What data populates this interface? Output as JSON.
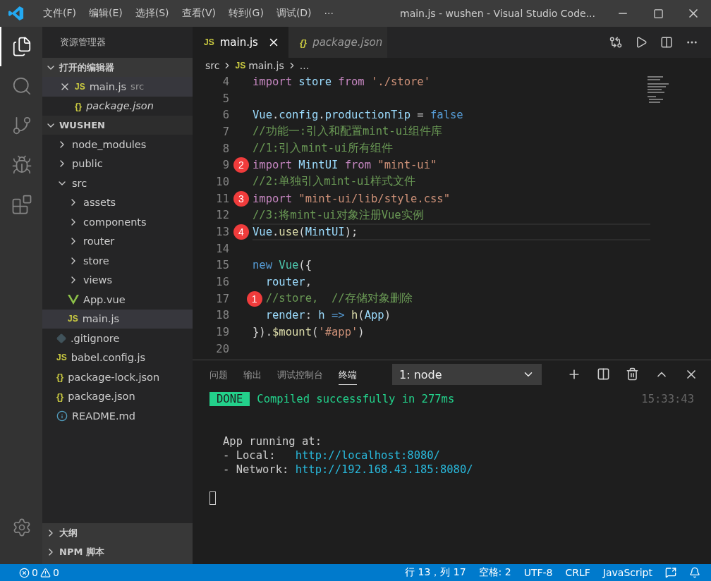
{
  "window": {
    "menus": [
      "文件(F)",
      "编辑(E)",
      "选择(S)",
      "查看(V)",
      "转到(G)",
      "调试(D)"
    ],
    "more": "···",
    "title": "main.js - wushen - Visual Studio Code..."
  },
  "activity_bar": [
    {
      "kind": "files",
      "selected": true
    },
    {
      "kind": "search",
      "selected": false
    },
    {
      "kind": "git",
      "selected": false
    },
    {
      "kind": "debug",
      "selected": false
    },
    {
      "kind": "extensions",
      "selected": false
    }
  ],
  "sidebar": {
    "title": "资源管理器",
    "open_editors": {
      "title": "打开的编辑器",
      "expanded": true,
      "items": [
        {
          "kind": "js",
          "icon": "JS",
          "label": "main.js",
          "hint": "src",
          "italic": false,
          "selected": true
        },
        {
          "kind": "json",
          "icon": "{}",
          "label": "package.json",
          "italic": true,
          "selected": false
        }
      ]
    },
    "project": {
      "title": "WUSHEN",
      "expanded": true,
      "items": [
        {
          "kind": "folder",
          "label": "node_modules",
          "expanded": false,
          "selected": false
        },
        {
          "kind": "folder",
          "label": "public",
          "expanded": false,
          "selected": false
        },
        {
          "kind": "folder",
          "label": "src",
          "expanded": true,
          "selected": false,
          "children": [
            {
              "kind": "folder",
              "label": "assets",
              "expanded": false,
              "selected": false
            },
            {
              "kind": "folder",
              "label": "components",
              "expanded": false,
              "selected": false
            },
            {
              "kind": "folder",
              "label": "router",
              "expanded": false,
              "selected": false
            },
            {
              "kind": "folder",
              "label": "store",
              "expanded": false,
              "selected": false
            },
            {
              "kind": "folder",
              "label": "views",
              "expanded": false,
              "selected": false
            },
            {
              "kind": "vue",
              "label": "App.vue",
              "selected": false
            },
            {
              "kind": "js",
              "icon": "JS",
              "label": "main.js",
              "selected": true
            }
          ]
        },
        {
          "kind": "git",
          "label": ".gitignore",
          "selected": false
        },
        {
          "kind": "js",
          "icon": "JS",
          "label": "babel.config.js",
          "selected": false
        },
        {
          "kind": "json",
          "icon": "{}",
          "label": "package-lock.json",
          "selected": false
        },
        {
          "kind": "json",
          "icon": "{}",
          "label": "package.json",
          "selected": false
        },
        {
          "kind": "info",
          "label": "README.md",
          "selected": false
        }
      ]
    },
    "bottom_sections": [
      {
        "title": "大纲",
        "expanded": false
      },
      {
        "title": "NPM 脚本",
        "expanded": false
      }
    ]
  },
  "tabs": [
    {
      "kind": "js",
      "icon": "JS",
      "label": "main.js",
      "italic": false,
      "selected": true
    },
    {
      "kind": "json",
      "icon": "{}",
      "label": "package.json",
      "italic": true,
      "selected": false
    }
  ],
  "breadcrumb": [
    {
      "label": "src"
    },
    {
      "kind": "js",
      "icon": "JS",
      "label": "main.js"
    },
    {
      "label": "..."
    }
  ],
  "code": [
    {
      "n": "4",
      "current": false,
      "tokens": [
        {
          "kind": "keyword",
          "text": "import "
        },
        {
          "kind": "variable",
          "text": "store "
        },
        {
          "kind": "keyword",
          "text": "from "
        },
        {
          "kind": "string",
          "text": "'./store'"
        }
      ]
    },
    {
      "n": "5",
      "current": false
    },
    {
      "n": "6",
      "current": false,
      "tokens": [
        {
          "kind": "variable",
          "text": "Vue"
        },
        {
          "kind": "plain",
          "text": "."
        },
        {
          "kind": "variable",
          "text": "config"
        },
        {
          "kind": "plain",
          "text": "."
        },
        {
          "kind": "variable",
          "text": "productionTip"
        },
        {
          "kind": "plain",
          "text": " = "
        },
        {
          "kind": "constant",
          "text": "false"
        }
      ]
    },
    {
      "n": "7",
      "current": false,
      "tokens": [
        {
          "kind": "comment",
          "text": "//功能一:引入和配置mint-ui组件库"
        }
      ]
    },
    {
      "n": "8",
      "current": false,
      "tokens": [
        {
          "kind": "comment",
          "text": "//1:引入mint-ui所有组件"
        }
      ]
    },
    {
      "n": "9",
      "current": false,
      "marker": "2",
      "tokens": [
        {
          "kind": "keyword",
          "text": "import "
        },
        {
          "kind": "variable",
          "text": "MintUI "
        },
        {
          "kind": "keyword",
          "text": "from "
        },
        {
          "kind": "string",
          "text": "\"mint-ui\""
        }
      ]
    },
    {
      "n": "10",
      "current": false,
      "tokens": [
        {
          "kind": "comment",
          "text": "//2:单独引入mint-ui样式文件"
        }
      ]
    },
    {
      "n": "11",
      "current": false,
      "marker": "3",
      "tokens": [
        {
          "kind": "keyword",
          "text": "import "
        },
        {
          "kind": "string",
          "text": "\"mint-ui/lib/style.css\""
        }
      ]
    },
    {
      "n": "12",
      "current": false,
      "tokens": [
        {
          "kind": "comment",
          "text": "//3:将mint-ui对象注册Vue实例"
        }
      ]
    },
    {
      "n": "13",
      "current": true,
      "marker": "4",
      "tokens": [
        {
          "kind": "variable",
          "text": "Vue"
        },
        {
          "kind": "plain",
          "text": "."
        },
        {
          "kind": "function",
          "text": "use"
        },
        {
          "kind": "plain",
          "text": "("
        },
        {
          "kind": "variable",
          "text": "MintUI"
        },
        {
          "kind": "plain",
          "text": ");"
        }
      ]
    },
    {
      "n": "14",
      "current": false
    },
    {
      "n": "15",
      "current": false,
      "tokens": [
        {
          "kind": "constant",
          "text": "new "
        },
        {
          "kind": "class",
          "text": "Vue"
        },
        {
          "kind": "plain",
          "text": "({"
        }
      ]
    },
    {
      "n": "16",
      "current": false,
      "tokens": [
        {
          "kind": "variable",
          "text": "  router"
        },
        {
          "kind": "plain",
          "text": ","
        }
      ]
    },
    {
      "n": "17",
      "current": false,
      "marker": "1",
      "tokens": [
        {
          "kind": "comment",
          "text": "  //store,  //存储对象删除"
        }
      ]
    },
    {
      "n": "18",
      "current": false,
      "tokens": [
        {
          "kind": "variable",
          "text": "  render"
        },
        {
          "kind": "plain",
          "text": ": "
        },
        {
          "kind": "variable",
          "text": "h "
        },
        {
          "kind": "constant",
          "text": "=> "
        },
        {
          "kind": "function",
          "text": "h"
        },
        {
          "kind": "plain",
          "text": "("
        },
        {
          "kind": "variable",
          "text": "App"
        },
        {
          "kind": "plain",
          "text": ")"
        }
      ]
    },
    {
      "n": "19",
      "current": false,
      "tokens": [
        {
          "kind": "plain",
          "text": "})."
        },
        {
          "kind": "function",
          "text": "$mount"
        },
        {
          "kind": "plain",
          "text": "("
        },
        {
          "kind": "string",
          "text": "'#app'"
        },
        {
          "kind": "plain",
          "text": ")"
        }
      ]
    },
    {
      "n": "20",
      "current": false
    }
  ],
  "panel": {
    "tabs": [
      {
        "label": "问题",
        "selected": false
      },
      {
        "label": "输出",
        "selected": false
      },
      {
        "label": "调试控制台",
        "selected": false
      },
      {
        "label": "终端",
        "selected": true
      }
    ],
    "terminal_select": "1: node",
    "terminal": {
      "badge": "DONE",
      "message": "Compiled successfully in 277ms",
      "time": "15:33:43",
      "lines": [
        {
          "label": "App running at:"
        },
        {
          "label": "- Local:   ",
          "link": "http://localhost:8080/"
        },
        {
          "label": "- Network: ",
          "link": "http://192.168.43.185:8080/"
        }
      ]
    }
  },
  "status_bar": {
    "errors": "0",
    "warnings": "0",
    "items": [
      "行 13，列 17",
      "空格: 2",
      "UTF-8",
      "CRLF",
      "JavaScript"
    ]
  }
}
